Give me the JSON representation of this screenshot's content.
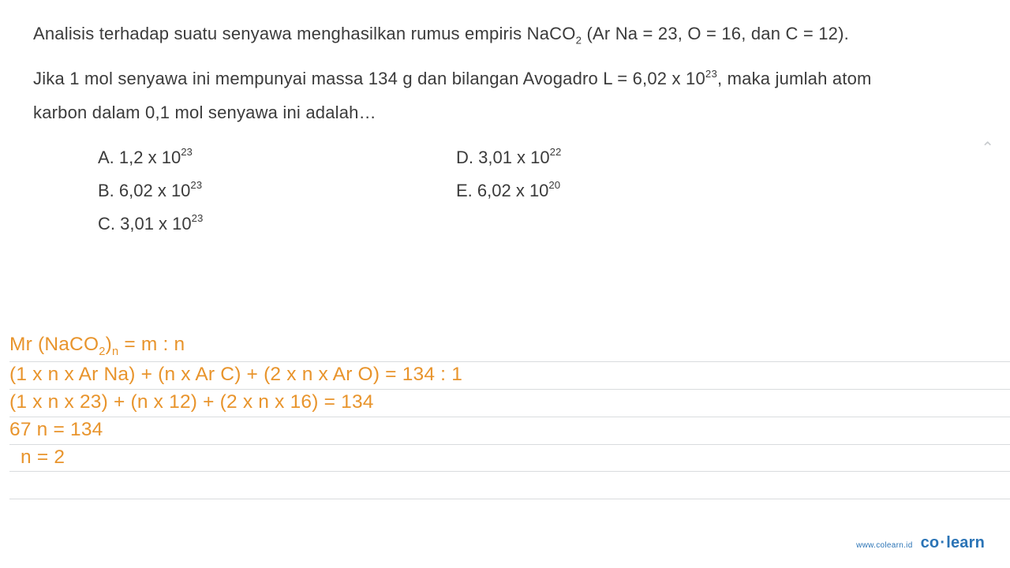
{
  "question": {
    "para1_pre": "Analisis terhadap suatu senyawa menghasilkan rumus empiris NaCO",
    "para1_sub": "2",
    "para1_post": " (Ar Na = 23, O = 16, dan C = 12).",
    "para2_pre": "Jika 1 mol senyawa ini mempunyai massa 134 g dan bilangan Avogadro L = 6,02 x 10",
    "para2_sup": "23",
    "para2_post": ", maka jumlah atom",
    "para3": "karbon dalam 0,1 mol senyawa ini adalah…"
  },
  "options": {
    "A": {
      "label": "A. ",
      "pre": "1,2 x 10",
      "sup": "23"
    },
    "B": {
      "label": "B. ",
      "pre": "6,02 x 10",
      "sup": "23"
    },
    "C": {
      "label": "C. ",
      "pre": "3,01 x 10",
      "sup": "23"
    },
    "D": {
      "label": "D. ",
      "pre": "3,01 x 10",
      "sup": "22"
    },
    "E": {
      "label": "E. ",
      "pre": "6,02 x 10",
      "sup": "20"
    }
  },
  "work": {
    "line1_pre": "Mr (NaCO",
    "line1_sub1": "2",
    "line1_mid": ")",
    "line1_sub2": "n",
    "line1_post": " = m : n",
    "line2": "(1 x n x Ar Na) + (n x Ar C) + (2 x n x Ar O) = 134 : 1",
    "line3": "(1 x n x 23) + (n x 12) + (2 x n x 16) = 134",
    "line4": "67 n = 134",
    "line5_pre": "  n = 2",
    "line6": " "
  },
  "footer": {
    "url": "www.colearn.id",
    "brand_a": "co",
    "brand_dot": "·",
    "brand_b": "learn"
  },
  "chevron": "⌃"
}
